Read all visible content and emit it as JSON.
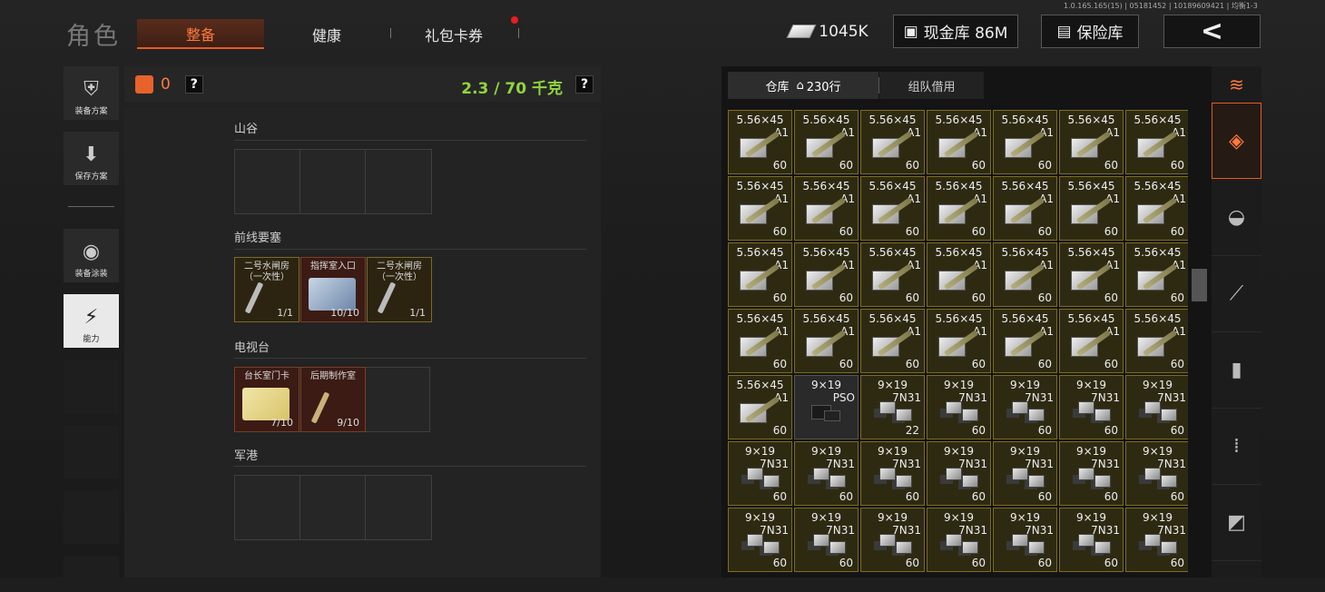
{
  "version": "1.0.165.165(15) | 05181452 | 10189609421 | 均衡1-3",
  "title": "角色",
  "tabs": [
    {
      "label": "整备",
      "active": true
    },
    {
      "label": "健康",
      "active": false
    },
    {
      "label": "礼包卡券",
      "active": false
    }
  ],
  "currency": {
    "cash": "1045K",
    "cash_vault": "现金库 86M",
    "safe": "保险库"
  },
  "left_buttons": {
    "loadout": "装备方案",
    "save": "保存方案",
    "skins": "装备涂装",
    "ability": "能力"
  },
  "backpack": {
    "count": "0",
    "weight": "2.3 / 70 千克",
    "help": "?"
  },
  "maps": [
    {
      "name": "山谷",
      "keys": []
    },
    {
      "name": "前线要塞",
      "keys": [
        {
          "name": "二号水闸房（一次性）",
          "count": "1/1",
          "kind": "key"
        },
        {
          "name": "指挥室入口",
          "count": "10/10",
          "kind": "card-blue"
        },
        {
          "name": "二号水闸房（一次性）",
          "count": "1/1",
          "kind": "key"
        }
      ]
    },
    {
      "name": "电视台",
      "keys": [
        {
          "name": "台长室门卡",
          "count": "7/10",
          "kind": "card"
        },
        {
          "name": "后期制作室",
          "count": "9/10",
          "kind": "key"
        }
      ]
    },
    {
      "name": "军港",
      "keys": []
    }
  ],
  "storage": {
    "tab_main": "仓库",
    "rows": "230行",
    "tab_team": "组队借用"
  },
  "ammo": {
    "a556": {
      "name": "5.56×45",
      "sub": "A1",
      "count": "60"
    },
    "a9pso": {
      "name": "9×19",
      "sub": "PSO",
      "count": ""
    },
    "a9_22": {
      "name": "9×19",
      "sub": "7N31",
      "count": "22"
    },
    "a9": {
      "name": "9×19",
      "sub": "7N31",
      "count": "60"
    }
  },
  "grid_layout": [
    "a556",
    "a556",
    "a556",
    "a556",
    "a556",
    "a556",
    "a556",
    "a556",
    "a556",
    "a556",
    "a556",
    "a556",
    "a556",
    "a556",
    "a556",
    "a556",
    "a556",
    "a556",
    "a556",
    "a556",
    "a556",
    "a556",
    "a556",
    "a556",
    "a556",
    "a556",
    "a556",
    "a556",
    "a556",
    "a9pso",
    "a9_22",
    "a9",
    "a9",
    "a9",
    "a9",
    "a9",
    "a9",
    "a9",
    "a9",
    "a9",
    "a9",
    "a9",
    "a9",
    "a9",
    "a9",
    "a9",
    "a9",
    "a9",
    "a9"
  ],
  "icons": [
    "cash-icon",
    "vault-icon",
    "safe-icon",
    "back-icon",
    "backpack-icon",
    "help-icon",
    "home-icon",
    "vest-icon",
    "helmet-icon",
    "rifle-icon",
    "magazine-icon",
    "bullet-icon",
    "pouch-icon"
  ]
}
